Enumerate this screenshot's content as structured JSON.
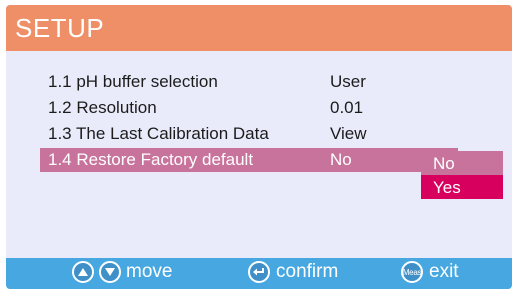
{
  "header": {
    "title": "SETUP"
  },
  "menu": {
    "items": [
      {
        "label": "1.1 pH buffer selection",
        "value": "User"
      },
      {
        "label": "1.2 Resolution",
        "value": "0.01"
      },
      {
        "label": "1.3 The Last Calibration Data",
        "value": "View"
      },
      {
        "label": "1.4 Restore Factory default",
        "value": "No"
      }
    ],
    "selected_index": 3
  },
  "dropdown": {
    "options": [
      "No",
      "Yes"
    ],
    "highlighted": "Yes"
  },
  "footer": {
    "move_label": "move",
    "confirm_label": "confirm",
    "meas_key_label": "Meas",
    "exit_label": "exit"
  },
  "colors": {
    "header": "#ee8f67",
    "selected_row": "#c8739b",
    "highlighted_option": "#d8005e",
    "footer": "#47a8e1",
    "background": "#e9ebfa"
  },
  "icons": [
    "up-arrow-icon",
    "down-arrow-icon",
    "enter-icon",
    "meas-key-icon"
  ]
}
